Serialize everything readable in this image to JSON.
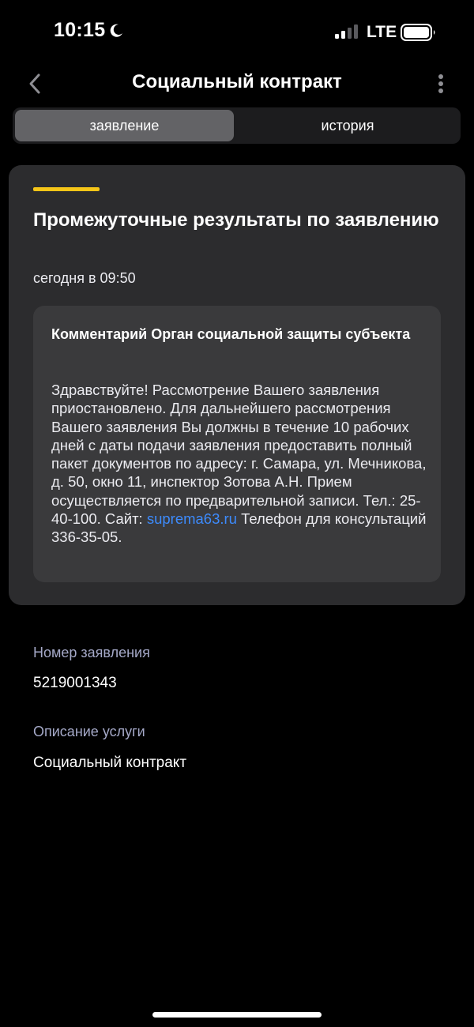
{
  "status_bar": {
    "time": "10:15",
    "network": "LTE"
  },
  "nav": {
    "title": "Социальный контракт"
  },
  "tabs": [
    {
      "label": "заявление",
      "active": true
    },
    {
      "label": "история",
      "active": false
    }
  ],
  "card": {
    "title": "Промежуточные результаты по заявлению",
    "date": "сегодня в 09:50",
    "comment": {
      "title": "Комментарий Орган социальной защиты субъекта",
      "text_before_link": "Здравствуйте! Рассмотрение Вашего заявления приостановлено. Для дальнейшего рассмотрения Вашего заявления Вы должны в течение 10 рабочих дней с даты подачи заявления предоставить полный пакет документов по адресу: г. Самара, ул. Мечникова, д. 50, окно 11, инспектор Зотова А.Н. Прием осуществляется по предварительной записи. Тел.: 25-40-100. Сайт: ",
      "link": "suprema63.ru",
      "text_after_link": " Телефон для консультаций 336-35-05."
    }
  },
  "details": {
    "application_number_label": "Номер заявления",
    "application_number": "5219001343",
    "service_description_label": "Описание услуги",
    "service_description": "Социальный контракт"
  },
  "colors": {
    "background": "#000000",
    "card": "#2c2c2e",
    "comment_box": "#3a3a3c",
    "accent": "#f5c518",
    "link": "#3d8bfd",
    "label": "#a5a9c8"
  },
  "icons": {
    "moon": "moon-icon",
    "signal": "signal-icon",
    "battery": "battery-icon",
    "back": "chevron-left-icon",
    "more": "more-vertical-icon"
  }
}
